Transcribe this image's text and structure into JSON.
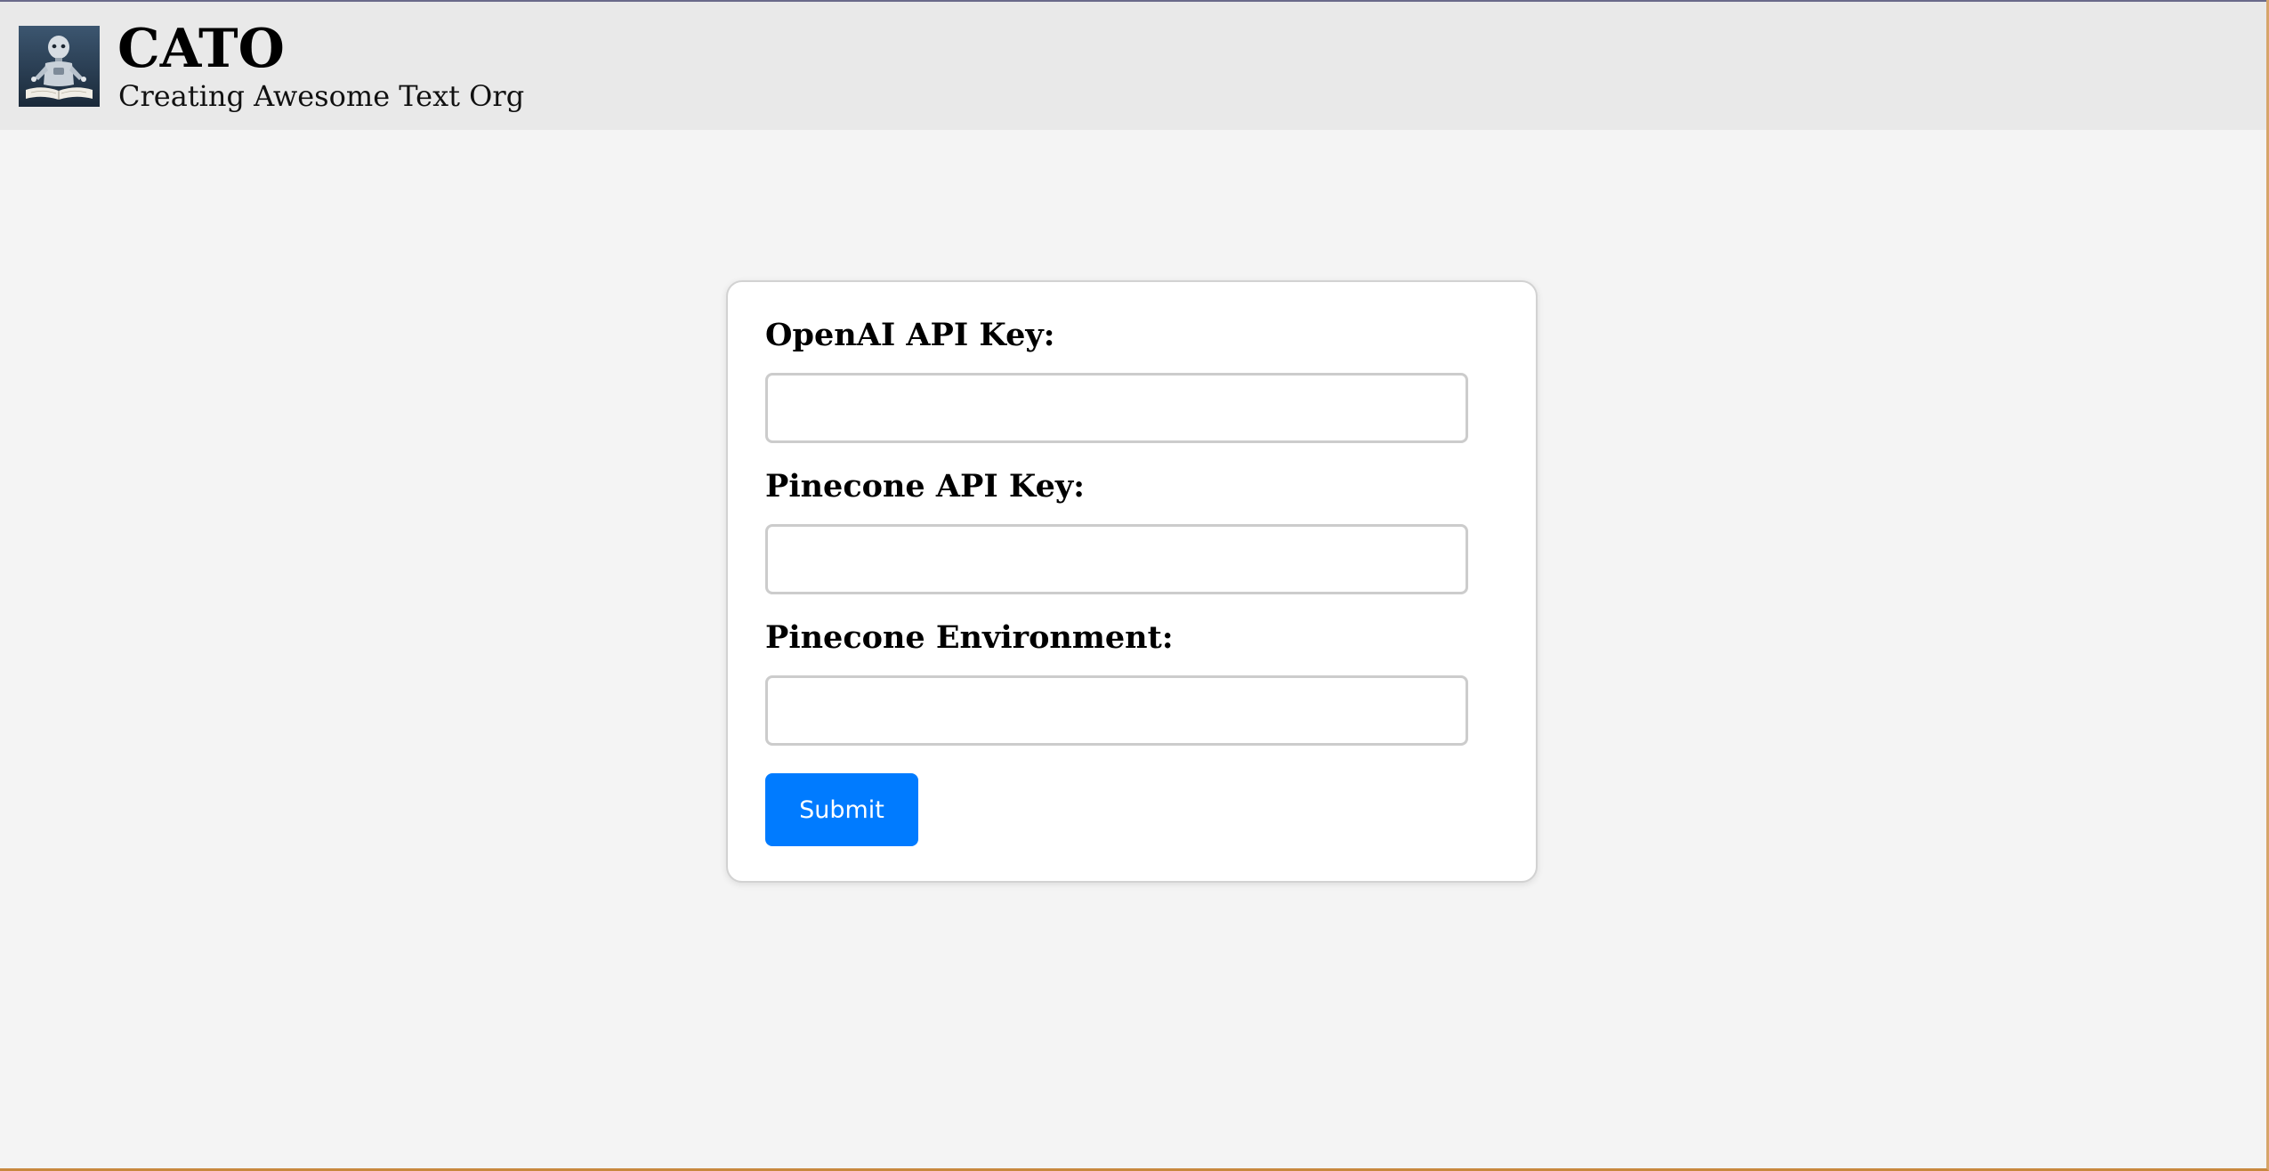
{
  "header": {
    "logo_icon": "robot-reading-book-icon",
    "title": "CATO",
    "subtitle": "Creating Awesome Text Org"
  },
  "form": {
    "fields": [
      {
        "label": "OpenAI API Key:",
        "value": "",
        "placeholder": ""
      },
      {
        "label": "Pinecone API Key:",
        "value": "",
        "placeholder": ""
      },
      {
        "label": "Pinecone Environment:",
        "value": "",
        "placeholder": ""
      }
    ],
    "submit_label": "Submit"
  },
  "colors": {
    "header_bg": "#e9e9e9",
    "page_bg": "#f4f4f4",
    "card_bg": "#ffffff",
    "button_bg": "#007bff",
    "button_text": "#ffffff"
  }
}
